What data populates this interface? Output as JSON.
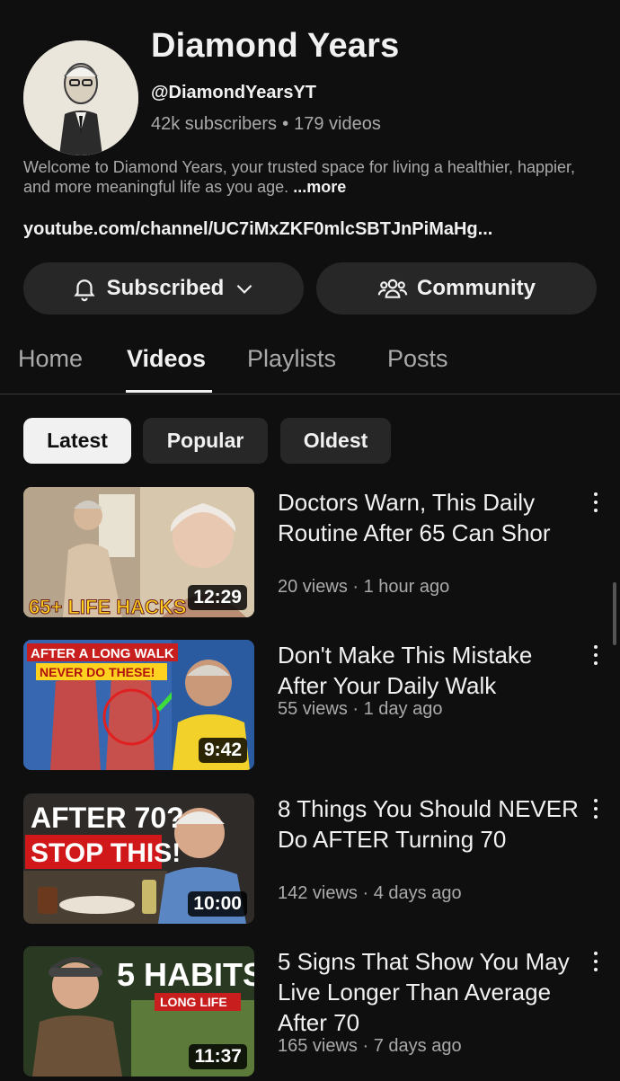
{
  "channel": {
    "title": "Diamond Years",
    "handle": "@DiamondYearsYT",
    "subscribers": "42k subscribers",
    "stats_separator": "•",
    "videos_count": "179 videos",
    "description": "Welcome to Diamond Years, your trusted space for living a healthier, happier, and more meaningful life as you age.",
    "more_label": "...more",
    "link": "youtube.com/channel/UC7iMxZKF0mlcSBTJnPiMaHg..."
  },
  "actions": {
    "subscribed_label": "Subscribed",
    "community_label": "Community"
  },
  "tabs": [
    {
      "label": "Home"
    },
    {
      "label": "Videos"
    },
    {
      "label": "Playlists"
    },
    {
      "label": "Posts"
    }
  ],
  "chips": [
    {
      "label": "Latest"
    },
    {
      "label": "Popular"
    },
    {
      "label": "Oldest"
    }
  ],
  "videos": [
    {
      "title": "Doctors Warn, This Daily Routine After 65 Can Shor",
      "meta": "20 views · 1 hour ago",
      "duration": "12:29",
      "thumb_text": "65+ LIFE HACKS"
    },
    {
      "title": "Don't Make This Mistake After Your Daily Walk",
      "meta": "55 views · 1 day ago",
      "duration": "9:42",
      "thumb_text_1": "AFTER A LONG WALK",
      "thumb_text_2": "NEVER DO THESE!"
    },
    {
      "title": "8 Things You Should NEVER Do AFTER Turning 70",
      "meta": "142 views · 4 days ago",
      "duration": "10:00",
      "thumb_text_1": "AFTER 70?",
      "thumb_text_2": "STOP THIS!"
    },
    {
      "title": "5 Signs That Show You May Live Longer Than Average After 70",
      "meta": "165 views · 7 days ago",
      "duration": "11:37",
      "thumb_text_1": "5 HABITS",
      "thumb_text_2": "LONG LIFE"
    }
  ]
}
